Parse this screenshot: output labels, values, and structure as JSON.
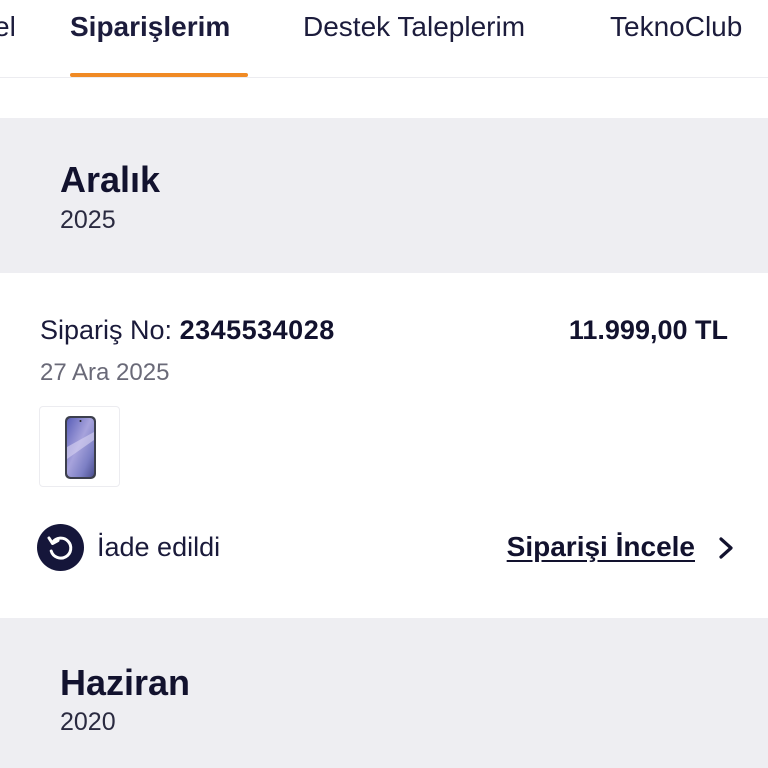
{
  "tabs": [
    {
      "label": "el"
    },
    {
      "label": "Siparişlerim",
      "active": true
    },
    {
      "label": "Destek Taleplerim"
    },
    {
      "label": "TeknoClub"
    }
  ],
  "months": [
    {
      "name": "Aralık",
      "year": "2025"
    },
    {
      "name": "Haziran",
      "year": "2020"
    }
  ],
  "order": {
    "no_label": "Sipariş No:",
    "no_value": "2345534028",
    "total": "11.999,00 TL",
    "date": "27 Ara 2025",
    "status": "İade edildi",
    "status_icon": "return-arrow-icon",
    "review_label": "Siparişi İncele",
    "product_icon": "smartphone-icon"
  },
  "colors": {
    "accent": "#f08a24",
    "navy": "#15163a",
    "section_bg": "#eeeef2"
  }
}
